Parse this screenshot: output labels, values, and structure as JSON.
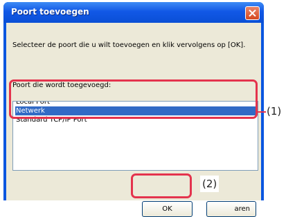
{
  "window": {
    "title": "Poort toevoegen",
    "close_icon": "close-icon"
  },
  "instruction": "Selecteer de poort die u wilt toevoegen en klik vervolgens op [OK].",
  "list_label": "Poort die wordt toegevoegd:",
  "port_list": {
    "items": [
      {
        "label": "Local Port",
        "selected": false
      },
      {
        "label": "Netwerk",
        "selected": true
      },
      {
        "label": "Standard TCP/IP Port",
        "selected": false
      }
    ]
  },
  "buttons": {
    "ok": "OK",
    "cancel": "aren"
  },
  "annotations": {
    "callout_1": "(1)",
    "callout_2": "(2)"
  },
  "colors": {
    "highlight": "#e4334d",
    "selection": "#316ac5",
    "titlebar": "#1258e6"
  }
}
